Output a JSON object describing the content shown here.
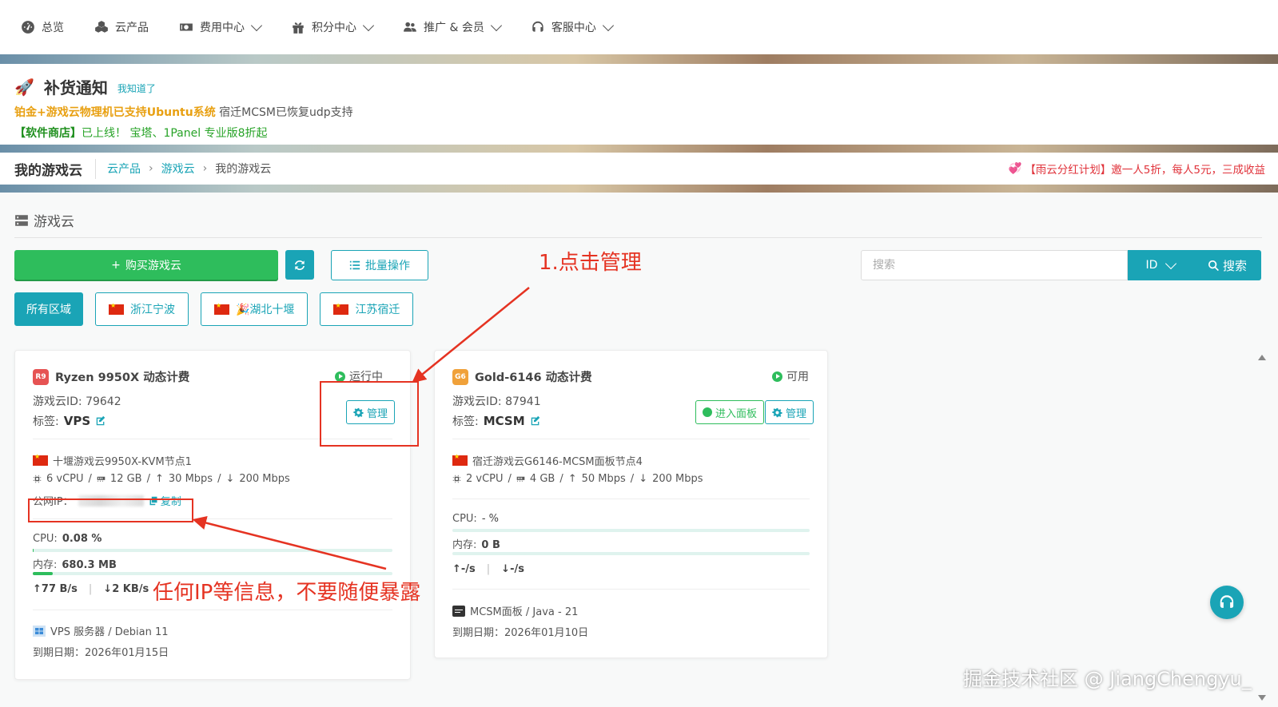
{
  "nav": {
    "items": [
      {
        "label": "总览",
        "icon": "dashboard-icon",
        "dropdown": false
      },
      {
        "label": "云产品",
        "icon": "cubes-icon",
        "dropdown": false
      },
      {
        "label": "费用中心",
        "icon": "money-icon",
        "dropdown": true
      },
      {
        "label": "积分中心",
        "icon": "gift-icon",
        "dropdown": true
      },
      {
        "label": "推广 & 会员",
        "icon": "users-icon",
        "dropdown": true
      },
      {
        "label": "客服中心",
        "icon": "headset-icon",
        "dropdown": true
      }
    ]
  },
  "notice": {
    "title": "补货通知",
    "ack": "我知道了",
    "line1_highlight": "铂金+游戏云物理机已支持Ubuntu系统",
    "line1_rest": "宿迁MCSM已恢复udp支持",
    "line2_bold": "【软件商店】",
    "line2_rest": "已上线！ 宝塔、1Panel 专业版8折起"
  },
  "breadcrumb": {
    "title": "我的游戏云",
    "items": [
      "云产品",
      "游戏云",
      "我的游戏云"
    ],
    "promo": "【雨云分红计划】邀一人5折，每人5元，三成收益"
  },
  "section": {
    "title": "游戏云"
  },
  "toolbar": {
    "buy_label": "购买游戏云",
    "batch_label": "批量操作",
    "search_placeholder": "搜索",
    "search_field": "ID",
    "search_button": "搜索"
  },
  "regions": [
    {
      "label": "所有区域",
      "active": true,
      "flag": false
    },
    {
      "label": "浙江宁波",
      "active": false,
      "flag": true
    },
    {
      "label": "🎉湖北十堰",
      "active": false,
      "flag": true
    },
    {
      "label": "江苏宿迁",
      "active": false,
      "flag": true
    }
  ],
  "cards": [
    {
      "chip": "R9",
      "name": "Ryzen 9950X 动态计费",
      "status": "运行中",
      "id_label": "游戏云ID: 79642",
      "tag_label": "标签:",
      "tag": "VPS",
      "manage": "管理",
      "node": "十堰游戏云9950X-KVM节点1",
      "cpu_spec": "6 vCPU",
      "mem_spec": "12 GB",
      "up_spec": "30 Mbps",
      "down_spec": "200 Mbps",
      "ip_label": "公网IP：",
      "copy": "复制",
      "cpu_label": "CPU:",
      "cpu_value": "0.08 %",
      "cpu_fraction": 0.0008,
      "mem_label": "内存:",
      "mem_value": "680.3 MB",
      "mem_fraction": 0.055,
      "net_up": "↑77 B/s",
      "net_down": "↓2 KB/s",
      "os": "VPS 服务器 / Debian 11",
      "expire": "到期日期：2026年01月15日"
    },
    {
      "chip": "G6",
      "name": "Gold-6146 动态计费",
      "status": "可用",
      "id_label": "游戏云ID: 87941",
      "tag_label": "标签:",
      "tag": "MCSM",
      "panel": "进入面板",
      "manage": "管理",
      "node": "宿迁游戏云G6146-MCSM面板节点4",
      "cpu_spec": "2 vCPU",
      "mem_spec": "4 GB",
      "up_spec": "50 Mbps",
      "down_spec": "200 Mbps",
      "cpu_label": "CPU:",
      "cpu_value": "- %",
      "cpu_fraction": 0,
      "mem_label": "内存:",
      "mem_value": "0 B",
      "mem_fraction": 0,
      "net_up": "↑-/s",
      "net_down": "↓-/s",
      "os": "MCSM面板 / Java - 21",
      "expire": "到期日期：2026年01月10日"
    }
  ],
  "annotations": {
    "step1": "1.点击管理",
    "warning": "任何IP等信息，不要随便暴露",
    "color": "#e53322"
  },
  "watermark": "掘金技术社区 @ JiangChengyu_",
  "colors": {
    "accent": "#1aa4b6",
    "success": "#2ebd5c",
    "promo": "#e0323a"
  }
}
